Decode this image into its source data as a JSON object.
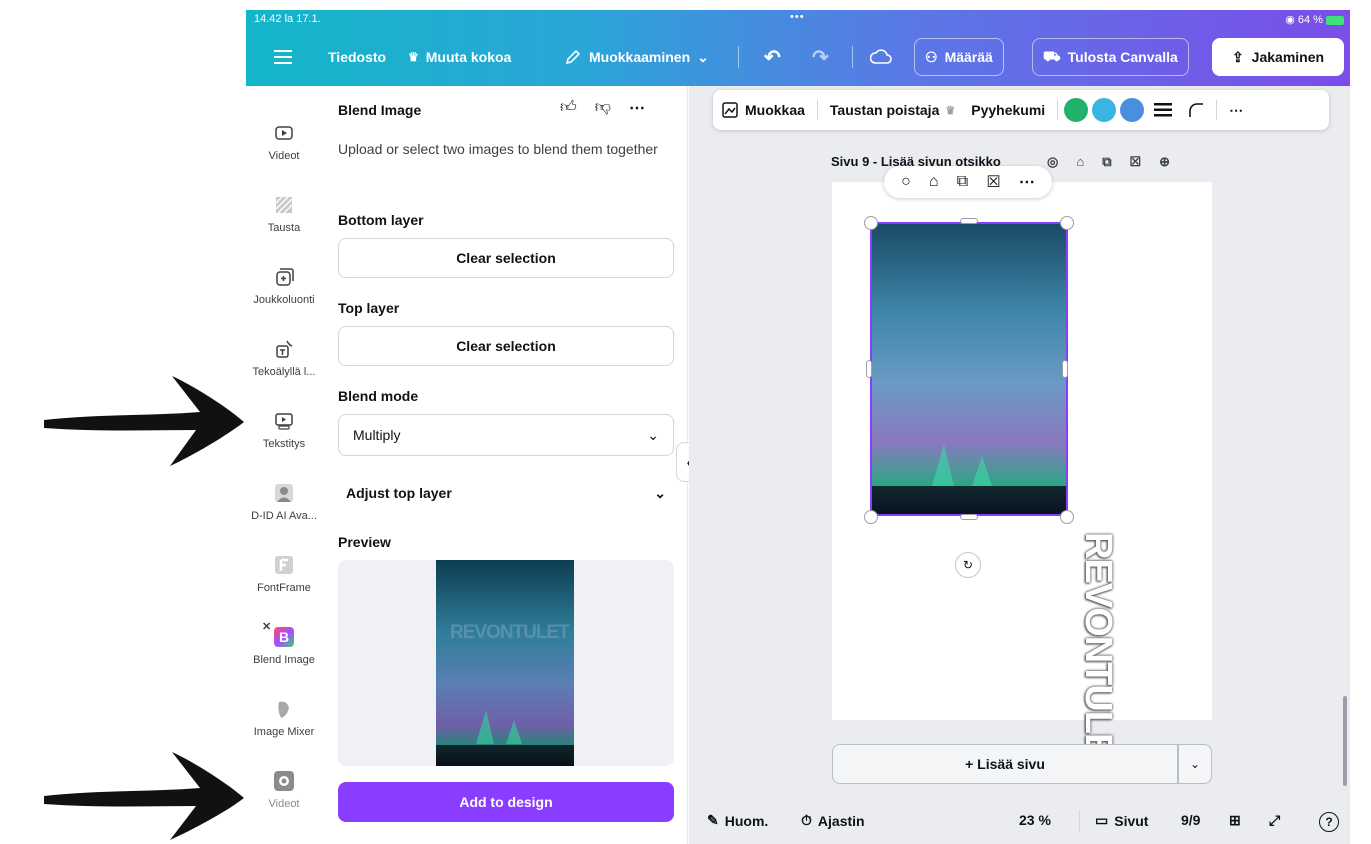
{
  "status": {
    "time": "14.42  la 17.1.",
    "dots": "•••",
    "battery": "64 %"
  },
  "topbar": {
    "file": "Tiedosto",
    "resize": "Muuta kokoa",
    "editing": "Muokkaaminen",
    "count": "Määrää",
    "print": "Tulosta Canvalla",
    "share": "Jakaminen"
  },
  "rail": {
    "items": [
      {
        "label": "Videot"
      },
      {
        "label": "Tausta"
      },
      {
        "label": "Joukkoluonti"
      },
      {
        "label": "Tekoälyllä l..."
      },
      {
        "label": "Tekstitys"
      },
      {
        "label": "D-ID AI Ava..."
      },
      {
        "label": "FontFrame"
      },
      {
        "label": "Blend Image"
      },
      {
        "label": "Image Mixer"
      },
      {
        "label": "Videot"
      }
    ]
  },
  "panel": {
    "title": "Blend Image",
    "description": "Upload or select two images to blend them together",
    "bottom_layer_label": "Bottom layer",
    "bottom_clear": "Clear selection",
    "top_layer_label": "Top layer",
    "top_clear": "Clear selection",
    "blend_mode_label": "Blend mode",
    "blend_mode_value": "Multiply",
    "adjust_label": "Adjust top layer",
    "preview_label": "Preview",
    "preview_text": "REVONTULET",
    "add_button": "Add to design"
  },
  "context_toolbar": {
    "edit": "Muokkaa",
    "bg_remove": "Taustan poistaja",
    "eraser": "Pyyhekumi",
    "colors": [
      "#20b26b",
      "#3ab4e0",
      "#4a8ee0"
    ]
  },
  "canvas": {
    "page_header": "Sivu 9 - Lisää sivun otsikko",
    "vertical_text": "REVONTULET",
    "add_page": "+ Lisää sivu"
  },
  "bottombar": {
    "notes": "Huom.",
    "timer": "Ajastin",
    "zoom": "23 %",
    "pages": "Sivut",
    "page_count": "9/9"
  }
}
